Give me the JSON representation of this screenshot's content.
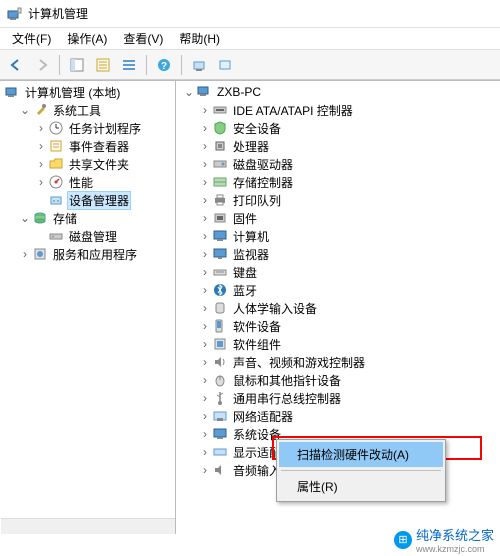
{
  "window": {
    "title": "计算机管理"
  },
  "menubar": {
    "file": "文件(F)",
    "action": "操作(A)",
    "view": "查看(V)",
    "help": "帮助(H)"
  },
  "left_tree": {
    "root": "计算机管理 (本地)",
    "system_tools": "系统工具",
    "task_scheduler": "任务计划程序",
    "event_viewer": "事件查看器",
    "shared_folders": "共享文件夹",
    "performance": "性能",
    "device_manager": "设备管理器",
    "storage": "存储",
    "disk_management": "磁盘管理",
    "services_apps": "服务和应用程序"
  },
  "right_tree": {
    "computer": "ZXB-PC",
    "ide": "IDE ATA/ATAPI 控制器",
    "security": "安全设备",
    "processors": "处理器",
    "disk_drives": "磁盘驱动器",
    "storage_ctrl": "存储控制器",
    "print_queue": "打印队列",
    "firmware": "固件",
    "computers": "计算机",
    "monitors": "监视器",
    "keyboards": "键盘",
    "bluetooth": "蓝牙",
    "hid": "人体学输入设备",
    "software_dev": "软件设备",
    "software_comp": "软件组件",
    "sound_game": "声音、视频和游戏控制器",
    "mice": "鼠标和其他指针设备",
    "usb": "通用串行总线控制器",
    "network": "网络适配器",
    "system_dev": "系统设备",
    "display": "显示适配",
    "audio_io": "音频输入和输出"
  },
  "context_menu": {
    "scan_hardware": "扫描检测硬件改动(A)",
    "properties": "属性(R)"
  },
  "watermark": {
    "text": "纯净系统之家",
    "url": "www.kzmzjc.com"
  }
}
